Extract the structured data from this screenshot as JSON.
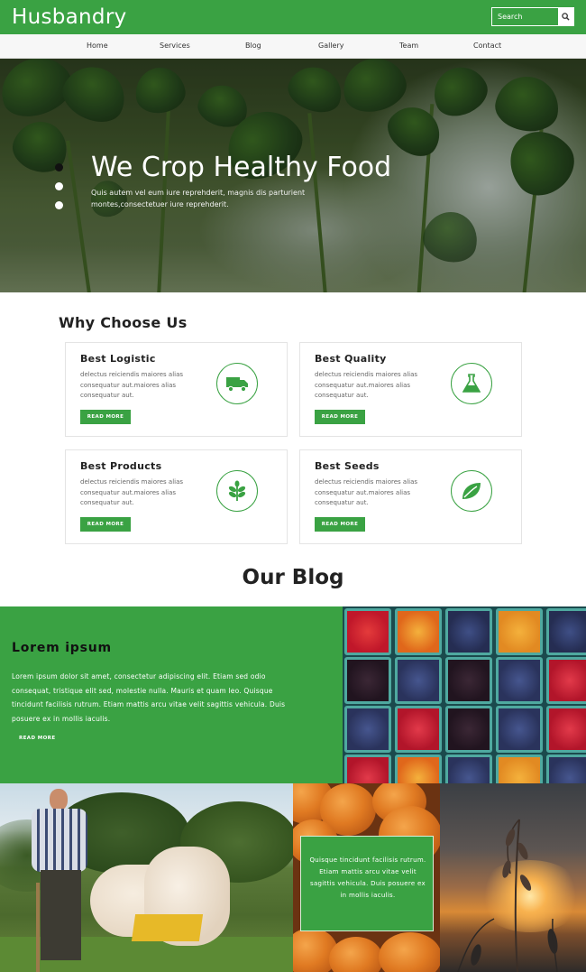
{
  "header": {
    "logo": "Husbandry",
    "search_placeholder": "Search"
  },
  "nav": [
    "Home",
    "Services",
    "Blog",
    "Gallery",
    "Team",
    "Contact"
  ],
  "hero": {
    "title": "We Crop Healthy Food",
    "subtitle": "Quis autem vel eum iure reprehderit, magnis dis parturient montes,consectetuer iure reprehderit.",
    "slides": 3,
    "active_slide": 1
  },
  "why": {
    "title": "Why Choose Us",
    "cards": [
      {
        "title": "Best Logistic",
        "text": "delectus reiciendis maiores alias consequatur aut.maiores alias consequatur aut.",
        "button": "READ MORE",
        "icon": "truck-icon"
      },
      {
        "title": "Best Quality",
        "text": "delectus reiciendis maiores alias consequatur aut.maiores alias consequatur aut.",
        "button": "READ MORE",
        "icon": "flask-icon"
      },
      {
        "title": "Best Products",
        "text": "delectus reiciendis maiores alias consequatur aut.maiores alias consequatur aut.",
        "button": "READ MORE",
        "icon": "plant-icon"
      },
      {
        "title": "Best Seeds",
        "text": "delectus reiciendis maiores alias consequatur aut.maiores alias consequatur aut.",
        "button": "READ MORE",
        "icon": "leaf-icon"
      }
    ]
  },
  "blog": {
    "title": "Our Blog",
    "post_title": "Lorem ipsum",
    "post_text": "Lorem ipsum dolor sit amet, consectetur adipiscing elit. Etiam sed odio consequat, tristique elit sed, molestie nulla. Mauris et quam leo. Quisque tincidunt facilisis rutrum. Etiam mattis arcu vitae velit sagittis vehicula. Duis posuere ex in mollis iaculis.",
    "post_more": "READ MORE",
    "quote": "Quisque tincidunt facilisis rutrum. Etiam mattis arcu vitae velit sagittis vehicula. Duis posuere ex in mollis iaculis."
  },
  "colors": {
    "brand_green": "#3aa243",
    "white": "#ffffff"
  }
}
